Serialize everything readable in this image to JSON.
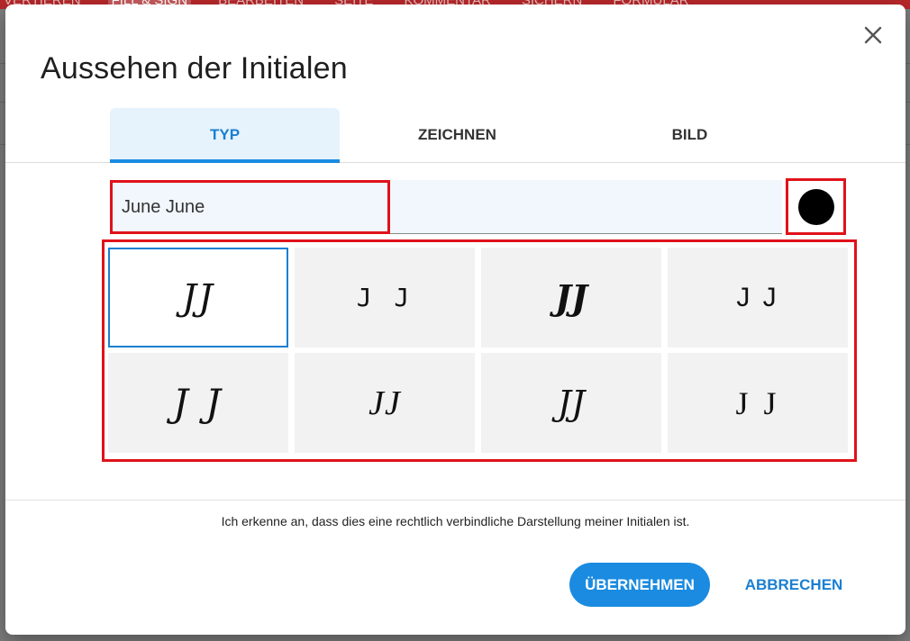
{
  "app": {
    "menu_tabs": [
      "VERTIEREN",
      "FILL & SIGN",
      "BEARBEITEN",
      "SEITE",
      "KOMMENTAR",
      "SICHERN",
      "FORMULAR"
    ]
  },
  "dialog": {
    "title": "Aussehen der Initialen",
    "tabs": [
      {
        "label": "TYP",
        "active": true
      },
      {
        "label": "ZEICHNEN",
        "active": false
      },
      {
        "label": "BILD",
        "active": false
      }
    ],
    "name_value": "June June",
    "color": "#000000",
    "initials_styles": [
      {
        "text": "JJ",
        "selected": true
      },
      {
        "text": "J J",
        "selected": false
      },
      {
        "text": "JJ",
        "selected": false
      },
      {
        "text": "J J",
        "selected": false
      },
      {
        "text": "J J",
        "selected": false
      },
      {
        "text": "JJ",
        "selected": false
      },
      {
        "text": "JJ",
        "selected": false
      },
      {
        "text": "J J",
        "selected": false
      }
    ],
    "consent_text": "Ich erkenne an, dass dies eine rechtlich verbindliche Darstellung meiner Initialen ist.",
    "apply_label": "ÜBERNEHMEN",
    "cancel_label": "ABBRECHEN"
  },
  "colors": {
    "accent": "#1a8be0",
    "highlight_border": "#e0121a",
    "topbar": "#b8282b"
  }
}
